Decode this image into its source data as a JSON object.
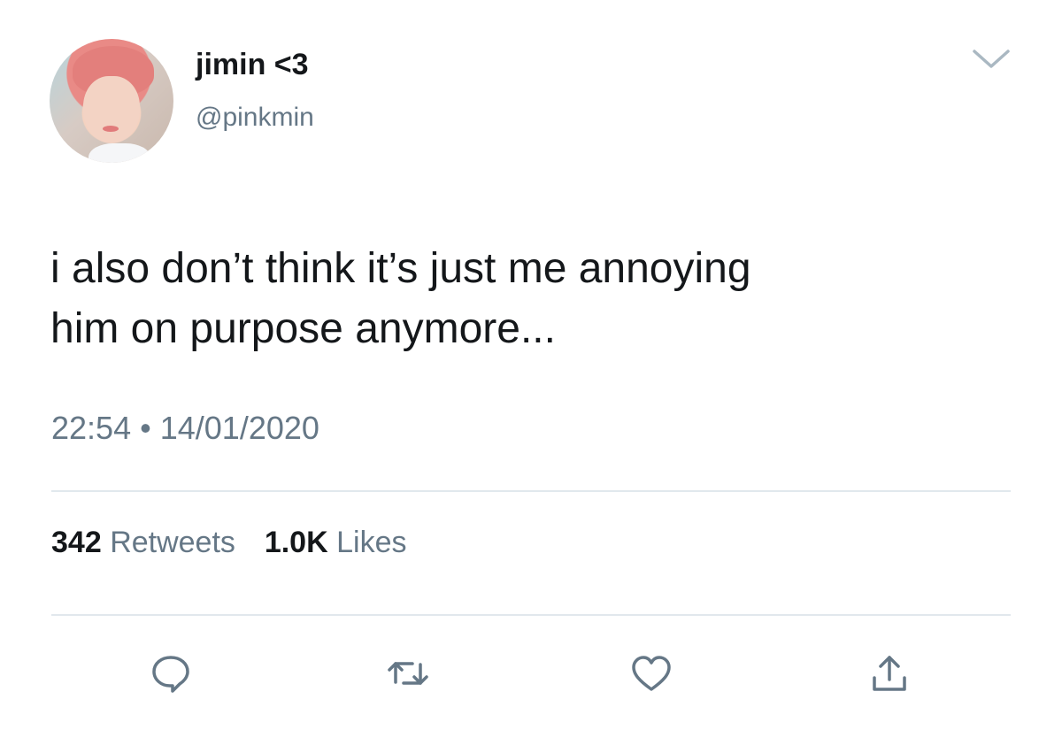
{
  "user": {
    "display_name": "jimin <3",
    "handle": "@pinkmin"
  },
  "tweet": {
    "text": "i also don’t think it’s just me annoying\nhim on purpose anymore...",
    "time": "22:54",
    "separator": "•",
    "date": "14/01/2020"
  },
  "stats": {
    "retweets_count": "342",
    "retweets_label": "Retweets",
    "likes_count": "1.0K",
    "likes_label": "Likes"
  },
  "colors": {
    "text": "#14171a",
    "secondary": "#657786",
    "divider": "#e1e8ed"
  },
  "icons": [
    "chevron-down-icon",
    "reply-icon",
    "retweet-icon",
    "like-icon",
    "share-icon"
  ]
}
